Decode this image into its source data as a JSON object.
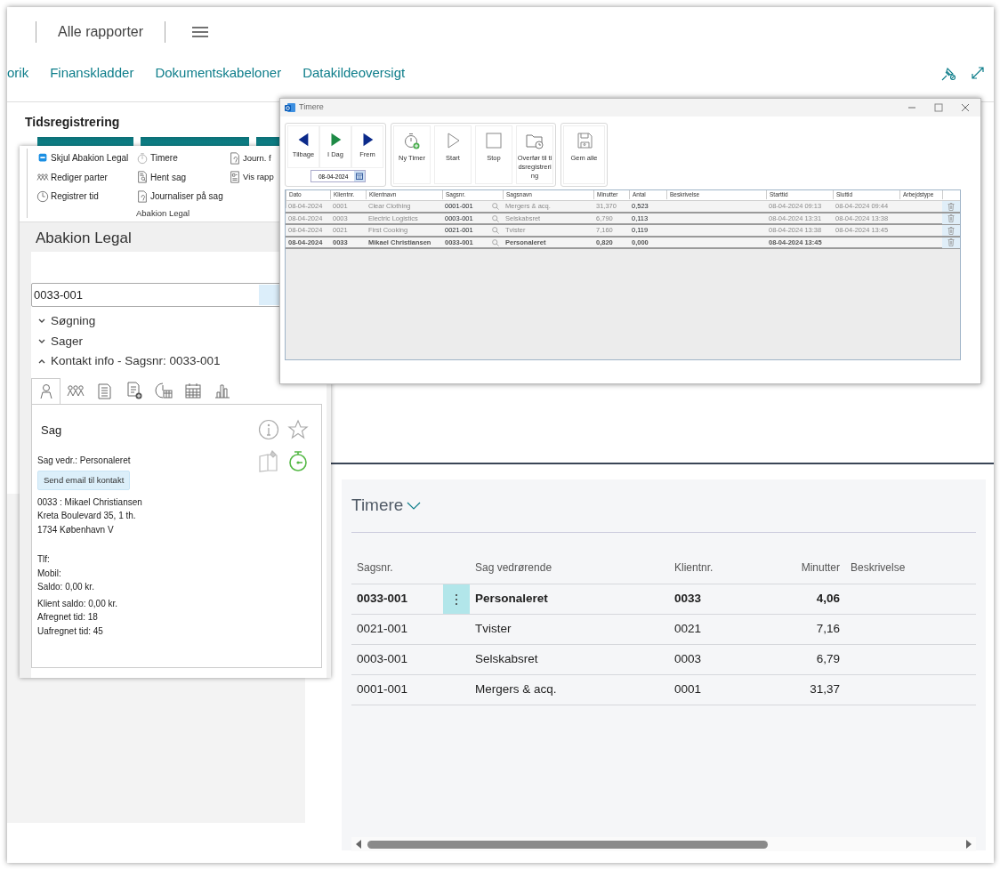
{
  "page": {
    "breadcrumb": "Alle rapporter",
    "nav_links": [
      "orik",
      "Finanskladder",
      "Dokumentskabeloner",
      "Datakildeoversigt"
    ],
    "section_title": "Tidsregistrering"
  },
  "abakion_panel": {
    "ribbon": {
      "columns": [
        [
          {
            "label": "Skjul Abakion Legal",
            "kind": "hide"
          },
          {
            "label": "Rediger parter",
            "kind": "people"
          },
          {
            "label": "Registrer tid",
            "kind": "clock"
          }
        ],
        [
          {
            "label": "Timere",
            "kind": "timer"
          },
          {
            "label": "Hent sag",
            "kind": "search-doc"
          },
          {
            "label": "Journaliser på sag",
            "kind": "doc"
          }
        ],
        [
          {
            "label": "Journ. f",
            "kind": "doc"
          },
          {
            "label": "Vis rapp",
            "kind": "report"
          }
        ]
      ],
      "group_label": "Abakion Legal"
    },
    "title": "Abakion Legal",
    "search": {
      "value": "0033-001"
    },
    "sections": [
      {
        "label": "Søgning",
        "expanded": false
      },
      {
        "label": "Sager",
        "expanded": false
      },
      {
        "label": "Kontakt info - Sagsnr: 0033-001",
        "expanded": true
      }
    ],
    "tabs": [
      {
        "kind": "person",
        "selected": true
      },
      {
        "kind": "people",
        "selected": false
      },
      {
        "kind": "document",
        "selected": false
      },
      {
        "kind": "document-add",
        "selected": false
      },
      {
        "kind": "clock-calendar",
        "selected": false
      },
      {
        "kind": "calendar",
        "selected": false
      },
      {
        "kind": "chart",
        "selected": false
      }
    ],
    "contact": {
      "heading": "Sag",
      "subject": "Sag vedr.: Personaleret",
      "email_button": "Send email til kontakt",
      "timer_active": true,
      "address": [
        "0033 : Mikael Christiansen",
        "Kreta Boulevard 35, 1 th.",
        "1734 København V"
      ],
      "details": [
        "Tlf:",
        "Mobil:",
        "Saldo: 0,00 kr."
      ],
      "balances": [
        "Klient saldo: 0,00 kr.",
        "Afregnet tid: 18",
        "Uafregnet tid: 45"
      ]
    }
  },
  "timere_window": {
    "title": "Timere",
    "nav_buttons": [
      {
        "label": "Tilbage",
        "kind": "back"
      },
      {
        "label": "I Dag",
        "kind": "today"
      },
      {
        "label": "Frem",
        "kind": "forward"
      }
    ],
    "date": "08-04-2024",
    "actions": [
      {
        "label": "Ny Timer",
        "kind": "new"
      },
      {
        "label": "Start",
        "kind": "start"
      },
      {
        "label": "Stop",
        "kind": "stop"
      },
      {
        "label": "Overfør til tidsregistrering",
        "kind": "transfer"
      }
    ],
    "save_button": "Gem alle",
    "grid": {
      "columns": [
        "Dato",
        "Klientnr.",
        "Klientnavn",
        "Sagsnr.",
        "Sagsnavn",
        "Minutter",
        "Antal",
        "Beskrivelse",
        "Starttid",
        "Sluttid",
        "Arbejdstype"
      ],
      "rows": [
        {
          "date": "08-04-2024",
          "client_no": "0001",
          "client_name": "Clear Clothing",
          "case_no": "0001-001",
          "case_name": "Mergers & acq.",
          "minutes": "31,370",
          "amount": "0,523",
          "start": "08-04-2024 09:13",
          "end": "08-04-2024 09:44",
          "active": false
        },
        {
          "date": "08-04-2024",
          "client_no": "0003",
          "client_name": "Electric Logistics",
          "case_no": "0003-001",
          "case_name": "Selskabsret",
          "minutes": "6,790",
          "amount": "0,113",
          "start": "08-04-2024 13:31",
          "end": "08-04-2024 13:38",
          "active": false
        },
        {
          "date": "08-04-2024",
          "client_no": "0021",
          "client_name": "First Cooking",
          "case_no": "0021-001",
          "case_name": "Tvister",
          "minutes": "7,160",
          "amount": "0,119",
          "start": "08-04-2024 13:38",
          "end": "08-04-2024 13:45",
          "active": false
        },
        {
          "date": "08-04-2024",
          "client_no": "0033",
          "client_name": "Mikael Christiansen",
          "case_no": "0033-001",
          "case_name": "Personaleret",
          "minutes": "0,820",
          "amount": "0,000",
          "start": "08-04-2024 13:45",
          "active": true
        }
      ]
    }
  },
  "timere_card": {
    "title": "Timere",
    "columns": [
      "Sagsnr.",
      "Sag vedrørende",
      "Klientnr.",
      "Minutter",
      "Beskrivelse"
    ],
    "rows": [
      {
        "case_no": "0033-001",
        "subject": "Personaleret",
        "client_no": "0033",
        "minutes": "4,06",
        "selected": true
      },
      {
        "case_no": "0021-001",
        "subject": "Tvister",
        "client_no": "0021",
        "minutes": "7,16",
        "selected": false
      },
      {
        "case_no": "0003-001",
        "subject": "Selskabsret",
        "client_no": "0003",
        "minutes": "6,79",
        "selected": false
      },
      {
        "case_no": "0001-001",
        "subject": "Mergers & acq.",
        "client_no": "0001",
        "minutes": "31,37",
        "selected": false
      }
    ]
  }
}
